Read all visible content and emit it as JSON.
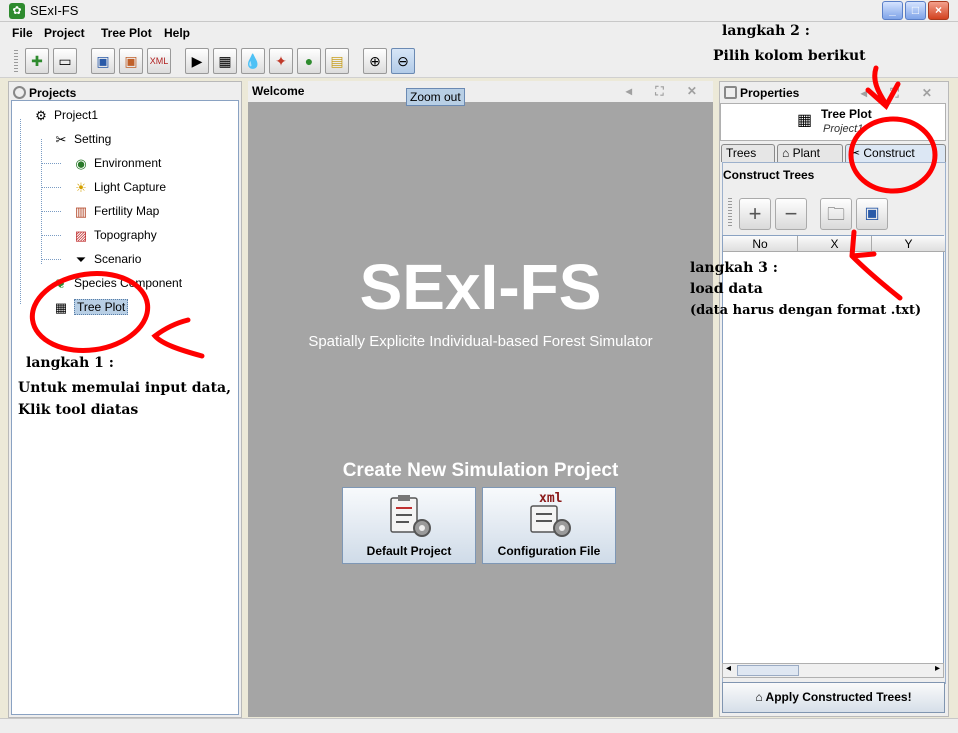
{
  "window": {
    "title": "SExI-FS"
  },
  "menu": [
    "File",
    "Project",
    "Tree Plot",
    "Help"
  ],
  "toolbar": {
    "icons": [
      "new-project-icon",
      "open-project-icon",
      "save-icon",
      "save-as-icon",
      "export-xml-icon",
      "run-icon",
      "grid-icon",
      "water-icon",
      "light-icon",
      "fertility-icon",
      "map-icon",
      "zoom-in-icon",
      "zoom-out-icon"
    ],
    "tooltip": "Zoom out"
  },
  "projects": {
    "header": "Projects",
    "nodes": [
      {
        "label": "Project1",
        "icon": "project-gear-icon"
      },
      {
        "label": "Setting",
        "icon": "tools-icon"
      },
      {
        "label": "Environment",
        "icon": "globe-icon"
      },
      {
        "label": "Light Capture",
        "icon": "sun-icon"
      },
      {
        "label": "Fertility Map",
        "icon": "fertility-map-icon"
      },
      {
        "label": "Topography",
        "icon": "topography-icon"
      },
      {
        "label": "Scenario",
        "icon": "funnel-icon"
      },
      {
        "label": "Species Component",
        "icon": "leaf-icon"
      },
      {
        "label": "Tree Plot",
        "icon": "grid-icon"
      }
    ]
  },
  "welcome": {
    "header": "Welcome",
    "app_name": "SExI-FS",
    "subtitle": "Spatially Explicite Individual-based Forest Simulator",
    "create_title": "Create New Simulation Project",
    "default_project": "Default Project",
    "configuration_file": "Configuration File",
    "xml_badge": "xml"
  },
  "properties": {
    "header": "Properties",
    "title": "Tree Plot",
    "subtitle": "Project1",
    "tabs": [
      "Trees",
      "Plant",
      "Construct"
    ],
    "section": "Construct Trees",
    "columns": [
      "No",
      "X",
      "Y"
    ],
    "apply": "Apply Constructed Trees!"
  },
  "annotations": {
    "step1_title": "langkah 1 :",
    "step1_line1": "Untuk memulai input data,",
    "step1_line2": "Klik tool diatas",
    "step2_title": "langkah 2 :",
    "step2_line1": "Pilih kolom berikut",
    "step3_title": "langkah 3 :",
    "step3_line1": "load data",
    "step3_line2": "(data harus dengan format .txt)"
  }
}
